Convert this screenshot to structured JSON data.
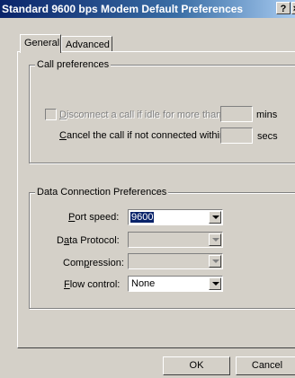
{
  "window": {
    "title": "Standard  9600 bps Modem Default Preferences",
    "help_glyph": "?",
    "close_glyph": "×"
  },
  "tabs": [
    {
      "label": "General",
      "active": true
    },
    {
      "label": "Advanced",
      "active": false
    }
  ],
  "call_preferences": {
    "legend": "Call preferences",
    "disconnect": {
      "prefix": "",
      "accel": "D",
      "rest": "isconnect a call if idle for more than",
      "unit": "mins",
      "checked": false,
      "enabled": false,
      "value": ""
    },
    "cancel": {
      "accel": "C",
      "rest": "ancel the call if not connected within",
      "unit": "secs",
      "value": ""
    }
  },
  "data_connection": {
    "legend": "Data Connection Preferences",
    "port_speed": {
      "pre": "",
      "accel": "P",
      "post": "ort speed:",
      "value": "9600"
    },
    "data_protocol": {
      "pre": "D",
      "accel": "a",
      "post": "ta Protocol:",
      "value": ""
    },
    "compression": {
      "pre": "Com",
      "accel": "p",
      "post": "ression:",
      "value": ""
    },
    "flow_control": {
      "pre": "",
      "accel": "F",
      "post": "low control:",
      "value": "None"
    }
  },
  "buttons": {
    "ok": "OK",
    "cancel": "Cancel"
  }
}
